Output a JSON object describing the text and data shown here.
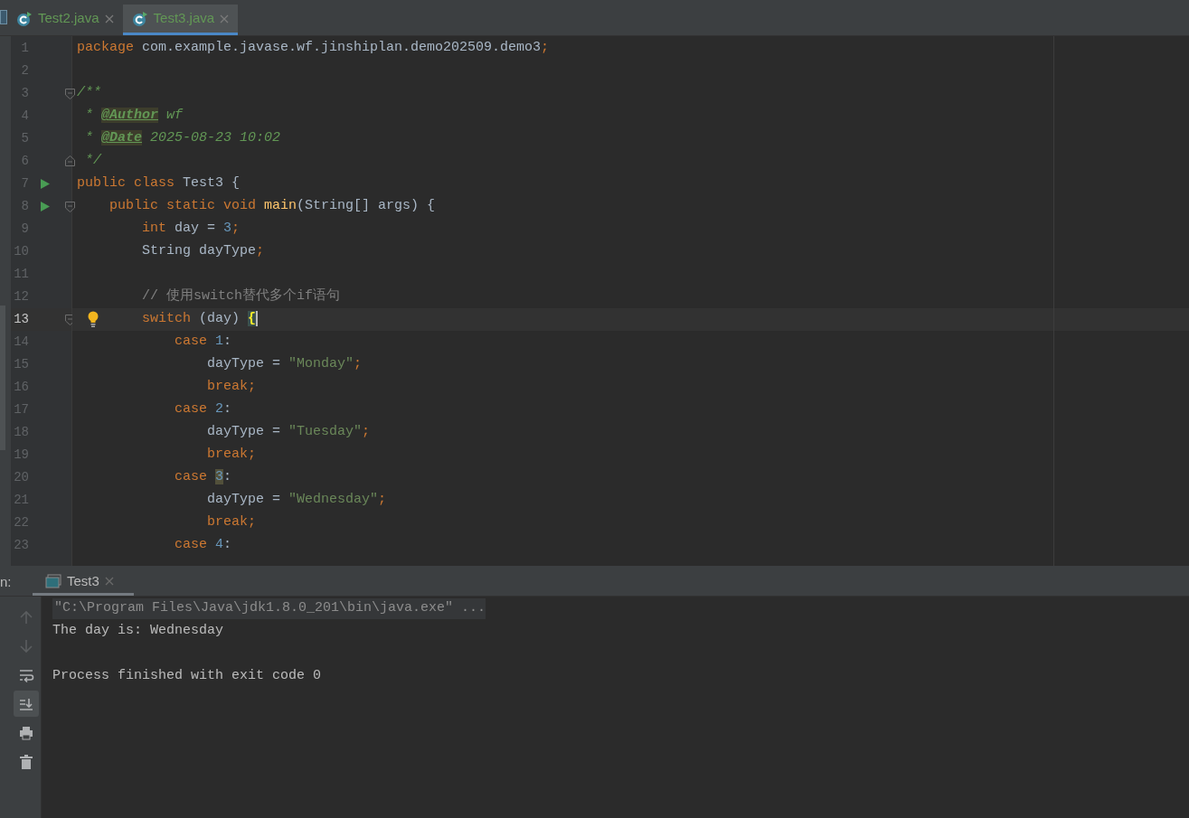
{
  "editor_tabs": [
    {
      "label": "Test2.java",
      "selected": false
    },
    {
      "label": "Test3.java",
      "selected": true
    }
  ],
  "code_lines": [
    {
      "number": "1",
      "current": false,
      "tokens": [
        {
          "kind": "keyword",
          "text": "package"
        },
        {
          "kind": "plain",
          "text": " com.example.javase.wf.jinshiplan.demo202509.demo3"
        },
        {
          "kind": "keyword",
          "text": ";"
        }
      ]
    },
    {
      "number": "2",
      "current": false
    },
    {
      "number": "3",
      "gutter": [
        {
          "kind": "fold_start"
        }
      ],
      "current": false,
      "tokens": [
        {
          "kind": "doc",
          "text": "/**"
        }
      ]
    },
    {
      "number": "4",
      "current": false,
      "tokens": [
        {
          "kind": "doc",
          "text": " * "
        },
        {
          "kind": "doc_tag",
          "text": "@Author"
        },
        {
          "kind": "doc",
          "text": " wf"
        }
      ]
    },
    {
      "number": "5",
      "current": false,
      "tokens": [
        {
          "kind": "doc",
          "text": " * "
        },
        {
          "kind": "doc_tag",
          "text": "@Date"
        },
        {
          "kind": "doc",
          "text": " 2025-08-23 10:02"
        }
      ]
    },
    {
      "number": "6",
      "gutter": [
        {
          "kind": "fold_end"
        }
      ],
      "current": false,
      "tokens": [
        {
          "kind": "doc",
          "text": " */"
        }
      ]
    },
    {
      "number": "7",
      "gutter": [
        {
          "kind": "run"
        }
      ],
      "current": false,
      "tokens": [
        {
          "kind": "keyword",
          "text": "public class"
        },
        {
          "kind": "plain",
          "text": " Test3 {"
        }
      ]
    },
    {
      "number": "8",
      "gutter": [
        {
          "kind": "run"
        },
        {
          "kind": "fold_start"
        }
      ],
      "current": false,
      "tokens": [
        {
          "kind": "keyword",
          "text": "    public static void "
        },
        {
          "kind": "method",
          "text": "main"
        },
        {
          "kind": "plain",
          "text": "(String[] args) {"
        }
      ]
    },
    {
      "number": "9",
      "current": false,
      "tokens": [
        {
          "kind": "keyword",
          "text": "        int"
        },
        {
          "kind": "plain",
          "text": " day = "
        },
        {
          "kind": "number",
          "text": "3"
        },
        {
          "kind": "keyword",
          "text": ";"
        }
      ]
    },
    {
      "number": "10",
      "current": false,
      "tokens": [
        {
          "kind": "plain",
          "text": "        String dayType"
        },
        {
          "kind": "keyword",
          "text": ";"
        }
      ]
    },
    {
      "number": "11",
      "current": false
    },
    {
      "number": "12",
      "current": false,
      "tokens": [
        {
          "kind": "comment",
          "text": "        // 使用switch替代多个if语句"
        }
      ]
    },
    {
      "number": "13",
      "gutter": [
        {
          "kind": "fold_start"
        },
        {
          "kind": "bulb"
        }
      ],
      "current": true,
      "tokens": [
        {
          "kind": "keyword",
          "text": "        switch"
        },
        {
          "kind": "plain",
          "text": " (day) "
        },
        {
          "kind": "brace_match",
          "text": "{"
        }
      ]
    },
    {
      "number": "14",
      "current": false,
      "tokens": [
        {
          "kind": "keyword",
          "text": "            case "
        },
        {
          "kind": "number",
          "text": "1"
        },
        {
          "kind": "plain",
          "text": ":"
        }
      ]
    },
    {
      "number": "15",
      "current": false,
      "tokens": [
        {
          "kind": "plain",
          "text": "                dayType = "
        },
        {
          "kind": "string",
          "text": "\"Monday\""
        },
        {
          "kind": "keyword",
          "text": ";"
        }
      ]
    },
    {
      "number": "16",
      "current": false,
      "tokens": [
        {
          "kind": "keyword",
          "text": "                break;"
        }
      ]
    },
    {
      "number": "17",
      "current": false,
      "tokens": [
        {
          "kind": "keyword",
          "text": "            case "
        },
        {
          "kind": "number",
          "text": "2"
        },
        {
          "kind": "plain",
          "text": ":"
        }
      ]
    },
    {
      "number": "18",
      "current": false,
      "tokens": [
        {
          "kind": "plain",
          "text": "                dayType = "
        },
        {
          "kind": "string",
          "text": "\"Tuesday\""
        },
        {
          "kind": "keyword",
          "text": ";"
        }
      ]
    },
    {
      "number": "19",
      "current": false,
      "tokens": [
        {
          "kind": "keyword",
          "text": "                break;"
        }
      ]
    },
    {
      "number": "20",
      "current": false,
      "tokens": [
        {
          "kind": "keyword",
          "text": "            case "
        },
        {
          "kind": "number_match",
          "text": "3"
        },
        {
          "kind": "plain",
          "text": ":"
        }
      ]
    },
    {
      "number": "21",
      "current": false,
      "tokens": [
        {
          "kind": "plain",
          "text": "                dayType = "
        },
        {
          "kind": "string",
          "text": "\"Wednesday\""
        },
        {
          "kind": "keyword",
          "text": ";"
        }
      ]
    },
    {
      "number": "22",
      "current": false,
      "tokens": [
        {
          "kind": "keyword",
          "text": "                break;"
        }
      ]
    },
    {
      "number": "23",
      "current": false,
      "tokens": [
        {
          "kind": "keyword",
          "text": "            case "
        },
        {
          "kind": "number",
          "text": "4"
        },
        {
          "kind": "plain",
          "text": ":"
        }
      ]
    }
  ],
  "run_panel": {
    "label": "n:",
    "tabs": [
      {
        "label": "Test3",
        "selected": true
      }
    ],
    "toolbar": [
      {
        "kind": "up",
        "disabled": true,
        "selected": false
      },
      {
        "kind": "down",
        "disabled": true,
        "selected": false
      },
      {
        "kind": "wrap",
        "disabled": false,
        "selected": false
      },
      {
        "kind": "scroll_end",
        "disabled": false,
        "selected": true
      },
      {
        "kind": "print",
        "disabled": false,
        "selected": false
      },
      {
        "kind": "trash",
        "disabled": false,
        "selected": false
      }
    ],
    "console": [
      {
        "kind": "command",
        "text": "\"C:\\Program Files\\Java\\jdk1.8.0_201\\bin\\java.exe\" ..."
      },
      {
        "kind": "output",
        "text": "The day is: Wednesday"
      },
      {
        "kind": "status",
        "text": "Process finished with exit code 0"
      }
    ]
  }
}
